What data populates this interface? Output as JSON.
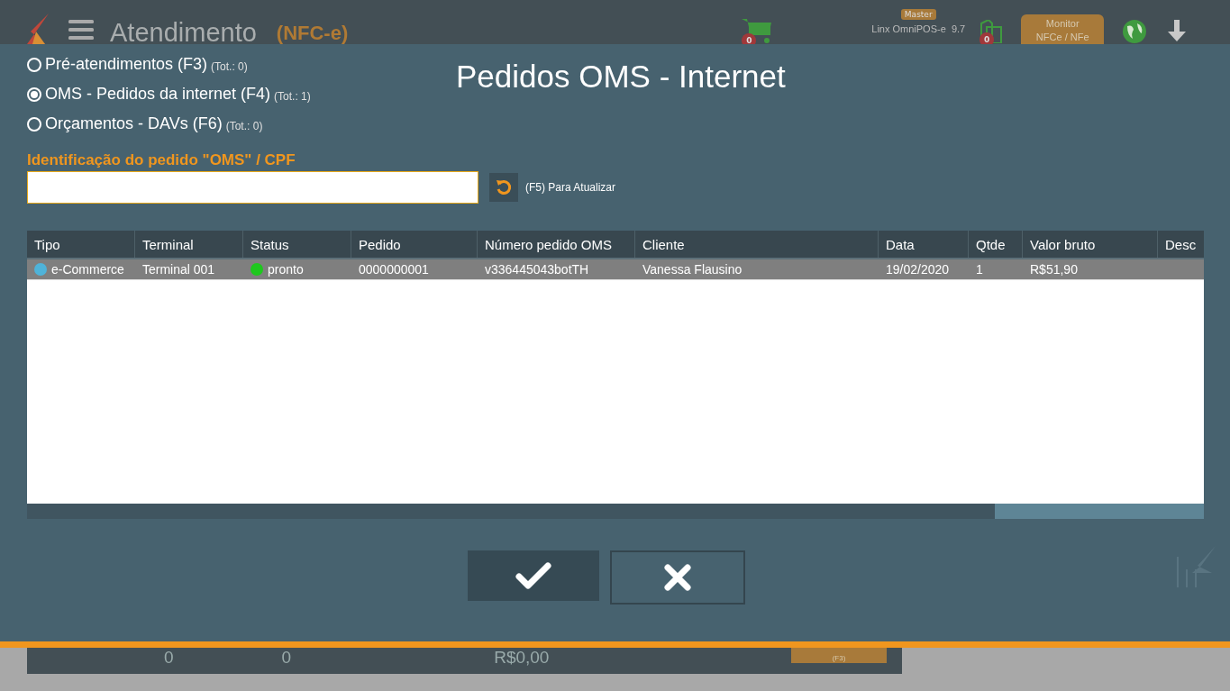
{
  "top_bar": {
    "title": "Atendimento",
    "mode": "(NFC-e)",
    "cart_count": "0",
    "profile_badge": "Master",
    "version_label": "Linx OmniPOS-e  9.7",
    "docs_count": "0",
    "monitor_button": [
      "Monitor",
      "NFCe / NFe"
    ]
  },
  "sources": [
    {
      "label": "Pré-atendimentos (F3)",
      "total": "(Tot.: 0)",
      "selected": false
    },
    {
      "label": "OMS - Pedidos da internet (F4)",
      "total": "(Tot.: 1)",
      "selected": true
    },
    {
      "label": "Orçamentos - DAVs (F6)",
      "total": "(Tot.: 0)",
      "selected": false
    }
  ],
  "dialog_title": "Pedidos OMS - Internet",
  "search": {
    "label": "Identificação do pedido \"OMS\" / CPF",
    "refresh_hint": "(F5) Para Atualizar"
  },
  "table": {
    "columns": [
      "Tipo",
      "Terminal",
      "Status",
      "Pedido",
      "Número pedido OMS",
      "Cliente",
      "Data",
      "Qtde",
      "Valor bruto",
      "Desc"
    ],
    "rows": [
      {
        "selected": true,
        "cells": [
          {
            "text": "e-Commerce",
            "color": "#4fb3d9"
          },
          {
            "text": "Terminal 001"
          },
          {
            "text": "pronto",
            "color": "#1ec81e"
          },
          {
            "text": "0000000001"
          },
          {
            "text": "v336445043botTH"
          },
          {
            "text": "Vanessa Flausino"
          },
          {
            "text": "19/02/2020"
          },
          {
            "text": "1"
          },
          {
            "text": "R$51,90"
          }
        ]
      }
    ]
  },
  "bottom_bar": {
    "items": [
      "0",
      "0",
      "R$0,00"
    ],
    "button_hint": "(F3)"
  }
}
